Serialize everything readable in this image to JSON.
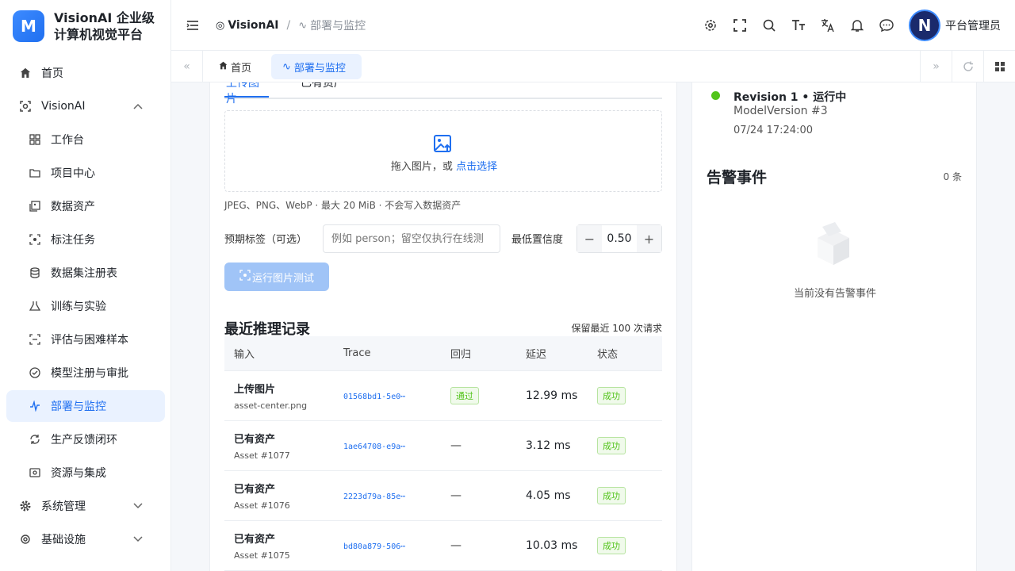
{
  "brand": {
    "logo_letter": "M",
    "title": "VisionAI 企业级计算机视觉平台"
  },
  "sidebar": {
    "items": [
      {
        "label": "首页",
        "icon": "home-icon"
      },
      {
        "label": "VisionAI",
        "icon": "vision-icon"
      },
      {
        "label": "工作台",
        "icon": "dashboard-icon"
      },
      {
        "label": "项目中心",
        "icon": "folder-icon"
      },
      {
        "label": "数据资产",
        "icon": "image-stack-icon"
      },
      {
        "label": "标注任务",
        "icon": "scan-icon"
      },
      {
        "label": "数据集注册表",
        "icon": "database-icon"
      },
      {
        "label": "训练与实验",
        "icon": "experiment-icon"
      },
      {
        "label": "评估与困难样本",
        "icon": "evaluate-icon"
      },
      {
        "label": "模型注册与审批",
        "icon": "check-circle-icon"
      },
      {
        "label": "部署与监控",
        "icon": "activity-icon"
      },
      {
        "label": "生产反馈闭环",
        "icon": "loop-icon"
      },
      {
        "label": "资源与集成",
        "icon": "integration-icon"
      },
      {
        "label": "系统管理",
        "icon": "gear-icon"
      },
      {
        "label": "基础设施",
        "icon": "infra-gear-icon"
      }
    ]
  },
  "header": {
    "crumb_root": "VisionAI",
    "crumb_sep": "/",
    "crumb_current": "部署与监控",
    "user_initial": "N",
    "user_name": "平台管理员"
  },
  "tabs": {
    "home": "首页",
    "deploy": "部署与监控"
  },
  "upload": {
    "tab_upload": "上传图片",
    "tab_asset": "已有资产",
    "drop_text": "拖入图片，或 ",
    "drop_link": "点击选择",
    "hint": "JPEG、PNG、WebP · 最大 20 MiB · 不会写入数据资产",
    "tag_label": "预期标签（可选）",
    "tag_placeholder": "例如 person；留空仅执行在线测",
    "conf_label": "最低置信度",
    "conf_value": "0.50",
    "minus": "−",
    "plus": "+",
    "run_label": "运行图片测试"
  },
  "records": {
    "title": "最近推理记录",
    "note": "保留最近 100 次请求",
    "columns": [
      "输入",
      "Trace",
      "回归",
      "延迟",
      "状态"
    ],
    "rows": [
      {
        "input": "上传图片",
        "sub": "asset-center.png",
        "trace": "01568bd1-5e0⋯",
        "regress": "通过",
        "latency": "12.99 ms",
        "status": "成功"
      },
      {
        "input": "已有资产",
        "sub": "Asset #1077",
        "trace": "1ae64708-e9a⋯",
        "regress": "—",
        "latency": "3.12 ms",
        "status": "成功"
      },
      {
        "input": "已有资产",
        "sub": "Asset #1076",
        "trace": "2223d79a-85e⋯",
        "regress": "—",
        "latency": "4.05 ms",
        "status": "成功"
      },
      {
        "input": "已有资产",
        "sub": "Asset #1075",
        "trace": "bd80a879-506⋯",
        "regress": "—",
        "latency": "10.03 ms",
        "status": "成功"
      }
    ]
  },
  "revision": {
    "title": "Revision 1 • 运行中",
    "model": "ModelVersion #3",
    "time": "07/24 17:24:00",
    "status_color": "#52c41a"
  },
  "alerts": {
    "title": "告警事件",
    "count": "0 条",
    "empty": "当前没有告警事件"
  },
  "colors": {
    "accent": "#1f6ff0",
    "success": "#52c41a"
  }
}
